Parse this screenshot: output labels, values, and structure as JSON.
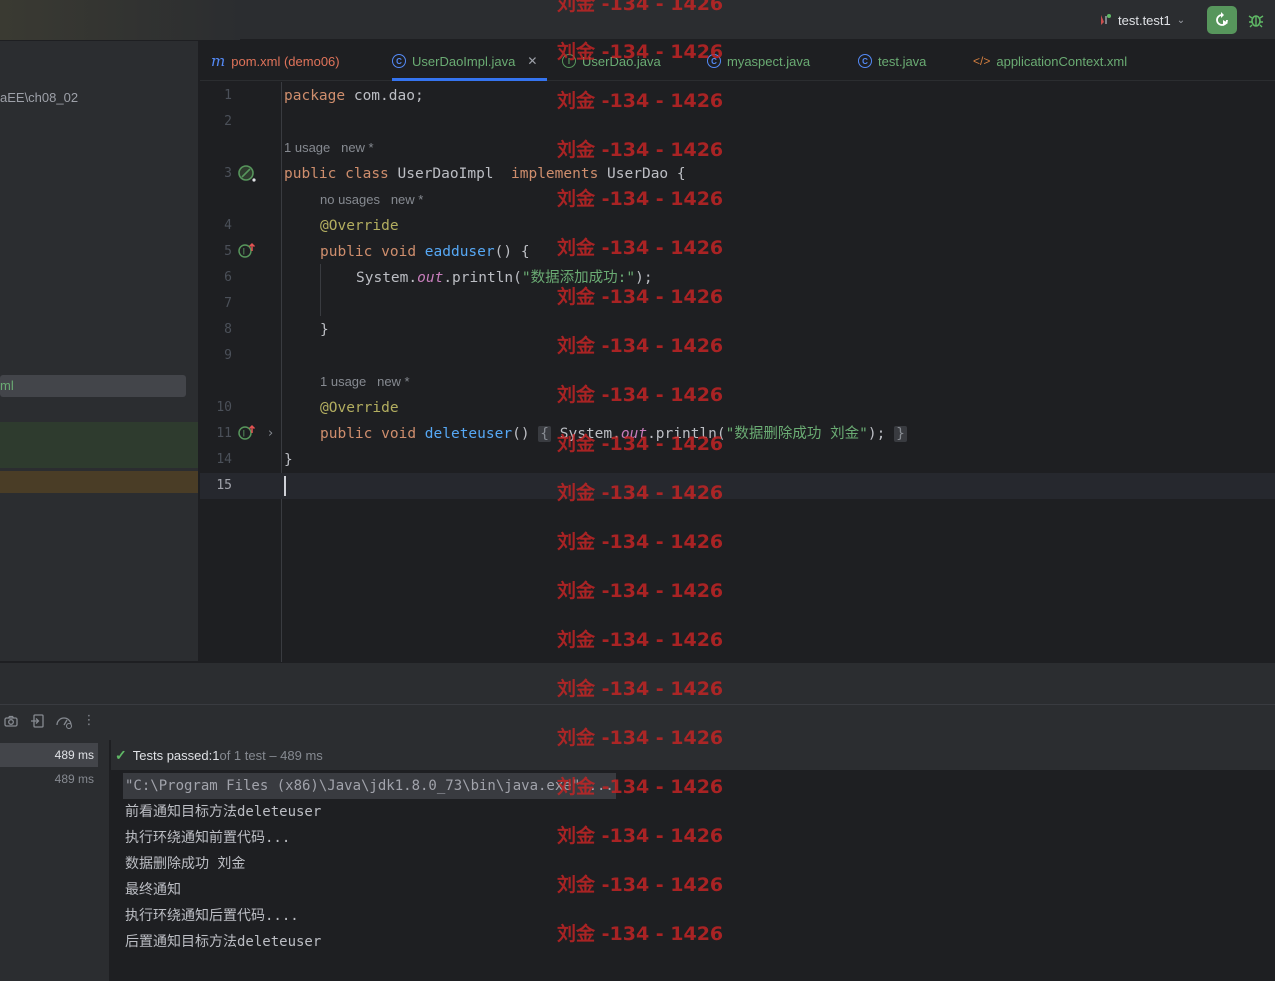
{
  "titlebar": {
    "run_config": "test.test1"
  },
  "project": {
    "path_fragment": "aEE\\ch08_02",
    "selected_item": "ml"
  },
  "tabs": [
    {
      "label": "pom.xml (demo06)",
      "icon": "maven-icon",
      "color": "#e0735a"
    },
    {
      "label": "UserDaoImpl.java",
      "icon": "class-icon",
      "color": "#6aab73",
      "active": true
    },
    {
      "label": "UserDao.java",
      "icon": "interface-icon",
      "color": "#6aab73"
    },
    {
      "label": "myaspect.java",
      "icon": "class-icon",
      "color": "#6aab73"
    },
    {
      "label": "test.java",
      "icon": "class-icon",
      "color": "#6aab73"
    },
    {
      "label": "applicationContext.xml",
      "icon": "xml-icon",
      "color": "#6aab73"
    }
  ],
  "editor": {
    "line_numbers": [
      "1",
      "2",
      "3",
      "4",
      "5",
      "6",
      "7",
      "8",
      "9",
      "10",
      "11",
      "14",
      "15"
    ],
    "code": {
      "l1_kw": "package",
      "l1_rest": " com.dao;",
      "l3_public": "public",
      "l3_class": "class",
      "l3_name": " UserDaoImpl  ",
      "l3_implements": "implements",
      "l3_rest": " UserDao {",
      "l4_ann": "@Override",
      "l5_public": "public",
      "l5_void": "void",
      "l5_fn": "eadduser",
      "l5_rest": "() {",
      "l6_a": "System.",
      "l6_out": "out",
      "l6_b": ".println(",
      "l6_str": "\"数据添加成功:\"",
      "l6_c": ");",
      "l8": "}",
      "l10_ann": "@Override",
      "l11_public": "public",
      "l11_void": "void",
      "l11_fn": "deleteuser",
      "l11_paren": "() ",
      "l11_open": "{",
      "l11_a": " System.",
      "l11_out": "out",
      "l11_b": ".println(",
      "l11_str": "\"数据删除成功 刘金\"",
      "l11_c": "); ",
      "l11_close": "}",
      "l14": "}"
    },
    "hints": {
      "class_usage": "1 usage   new *",
      "eadd_usage": "no usages   new *",
      "delete_usage": "1 usage   new *"
    }
  },
  "run": {
    "tree": [
      {
        "time": "489 ms"
      },
      {
        "time": "489 ms"
      }
    ],
    "status": {
      "prefix": "Tests passed: ",
      "count": "1",
      "suffix": " of 1 test – 489 ms"
    },
    "console_lines": [
      "\"C:\\Program Files (x86)\\Java\\jdk1.8.0_73\\bin\\java.exe\" ...",
      "前看通知目标方法deleteuser",
      "执行环绕通知前置代码...",
      "数据删除成功 刘金",
      "最终通知",
      "执行环绕通知后置代码....",
      "后置通知目标方法deleteuser"
    ]
  },
  "watermark": "刘金 -134 - 1426",
  "colors": {
    "accent": "#3574f0",
    "run_green": "#57965c",
    "watermark": "#c82424"
  }
}
